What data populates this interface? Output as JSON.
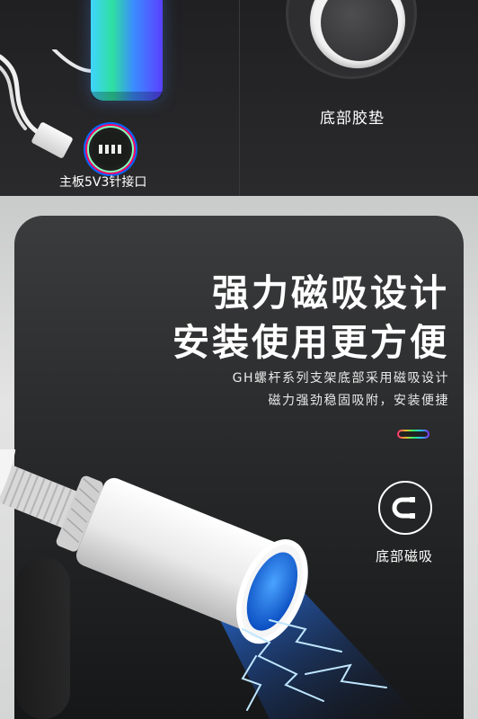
{
  "top": {
    "caption_motherboard": "主板5V3针接口",
    "caption_pad": "底部胶垫"
  },
  "feature": {
    "title_line1": "强力磁吸设计",
    "title_line2": "安装使用更方便",
    "desc_line1": "GH螺杆系列支架底部采用磁吸设计",
    "desc_line2": "磁力强劲稳固吸附，安装便捷",
    "badge_caption": "底部磁吸",
    "badge_icon": "magnet-icon"
  },
  "colors": {
    "card_bg": "#2a2b2c",
    "frame_bg": "#dcdcdc",
    "text": "#ffffff",
    "accent_blue": "#1f6fe0"
  }
}
